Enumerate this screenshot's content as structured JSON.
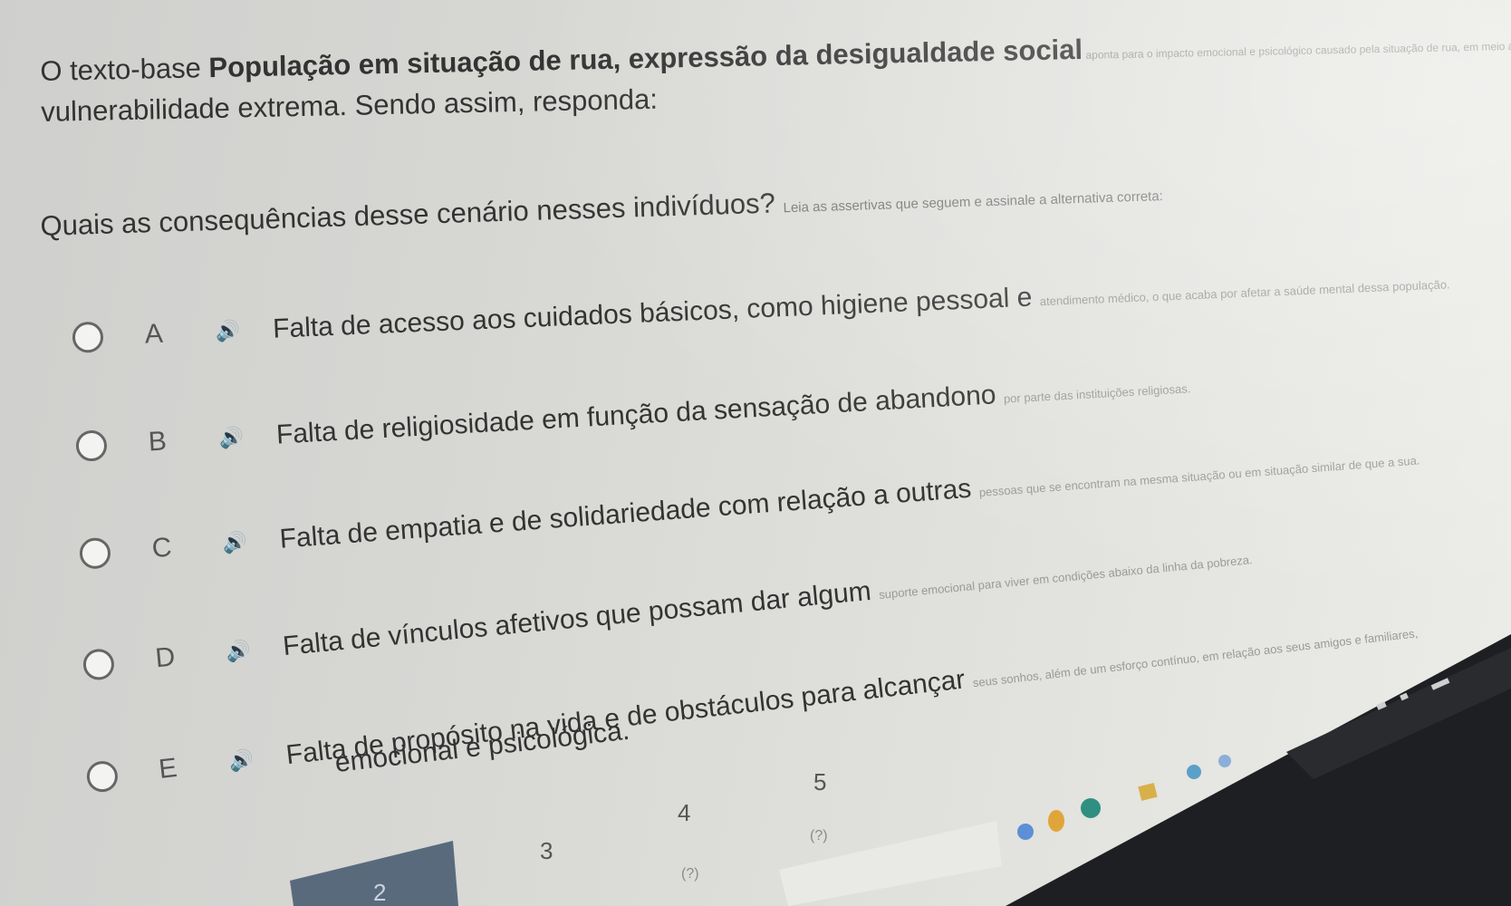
{
  "question": {
    "intro_prefix": "O texto-base ",
    "intro_title": "População em situação de rua, expressão da desigualdade social",
    "intro_faded": " aponta para o impacto emocional e psicológico causado pela situação de rua, em meio a uma situação de",
    "intro_line2": "vulnerabilidade extrema. Sendo assim, responda:",
    "prompt_main": "Quais as consequências desse cenário nesses indivíduos? ",
    "prompt_faded": "Leia as assertivas que seguem e assinale a alternativa correta:"
  },
  "options": [
    {
      "letter": "A",
      "text": "Falta de acesso aos cuidados básicos, como higiene pessoal e ",
      "faded": "atendimento médico, o que acaba por afetar a saúde mental dessa população."
    },
    {
      "letter": "B",
      "text": "Falta de religiosidade em função da sensação de abandono ",
      "faded": "por parte das instituições religiosas."
    },
    {
      "letter": "C",
      "text": "Falta de empatia e de solidariedade com relação a outras ",
      "faded": "pessoas que se encontram na mesma situação ou em situação similar de que a sua."
    },
    {
      "letter": "D",
      "text": "Falta de vínculos afetivos que possam dar algum ",
      "faded": "suporte emocional para viver em condições abaixo da linha da pobreza."
    },
    {
      "letter": "E",
      "text": "Falta de propósito na vida e de obstáculos para alcançar ",
      "faded": "seus sonhos, além de um esforço contínuo, em relação aos seus amigos e familiares,",
      "text_line2": "emocional e psicológica."
    }
  ],
  "icons": {
    "speaker": "speaker-icon"
  },
  "navigation": {
    "steps": [
      "2",
      "3",
      "4",
      "5"
    ],
    "hints": [
      "(?)",
      "(?)"
    ]
  },
  "colors": {
    "taskbar": "#1e1f22",
    "step_active": "#5a6a7d",
    "accent_icon": "#2f8f80"
  }
}
